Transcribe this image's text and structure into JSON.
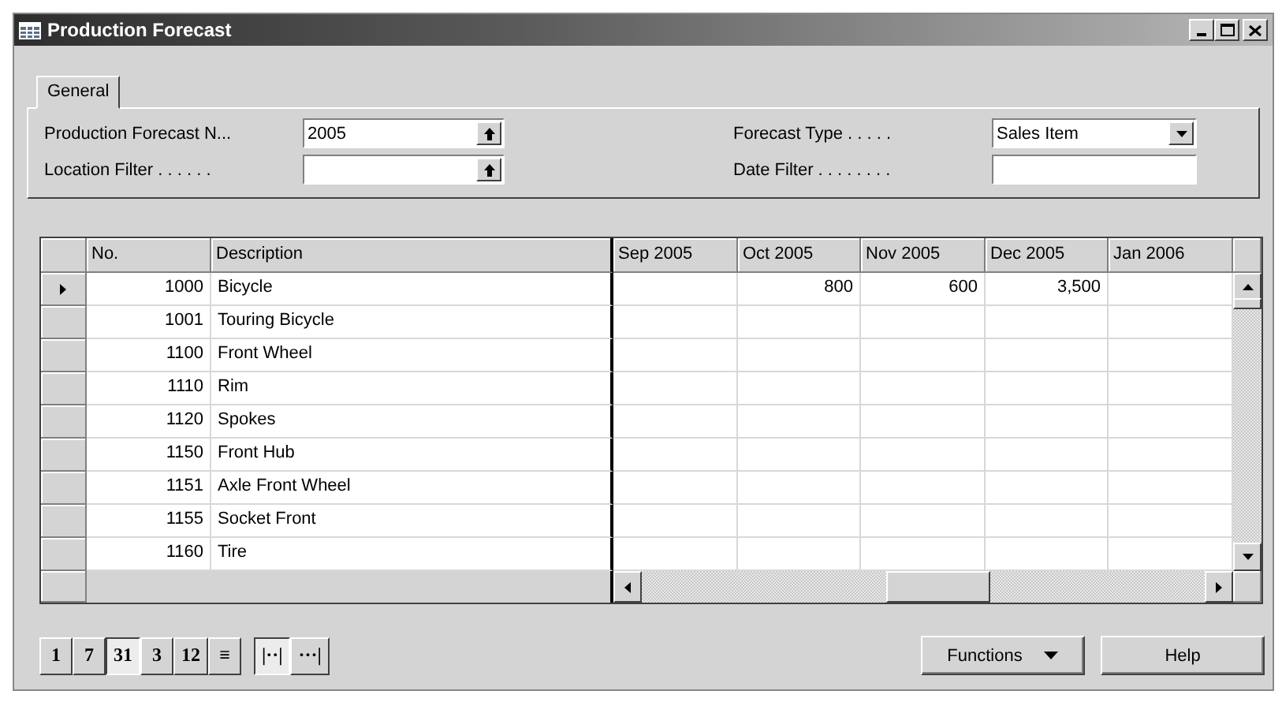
{
  "window": {
    "title": "Production Forecast"
  },
  "tabs": [
    {
      "label": "General",
      "selected": true
    }
  ],
  "left_fields": [
    {
      "label": "Production Forecast N...",
      "value": "2005",
      "kind": "lookup"
    },
    {
      "label": "Location Filter . . . . . .",
      "kind": "lookup"
    }
  ],
  "right_fields": [
    {
      "label": "Forecast Type . . . . .",
      "value": "Sales Item",
      "kind": "dropdown"
    },
    {
      "label": "Date Filter . . . . . . . .",
      "kind": "text"
    }
  ],
  "table": {
    "columns": [
      "No.",
      "Description",
      "Sep 2005",
      "Oct 2005",
      "Nov 2005",
      "Dec 2005",
      "Jan 2006"
    ],
    "rows": [
      {
        "no": "1000",
        "description": "Bicycle",
        "selected": true,
        "values": {
          "1": "800",
          "2": "600",
          "3": "3,500"
        }
      },
      {
        "no": "1001",
        "description": "Touring Bicycle",
        "selected": false
      },
      {
        "no": "1100",
        "description": "Front Wheel",
        "selected": false
      },
      {
        "no": "1110",
        "description": "Rim",
        "selected": false
      },
      {
        "no": "1120",
        "description": "Spokes",
        "selected": false
      },
      {
        "no": "1150",
        "description": "Front Hub",
        "selected": false
      },
      {
        "no": "1151",
        "description": "Axle Front Wheel",
        "selected": false
      },
      {
        "no": "1155",
        "description": "Socket Front",
        "selected": false
      },
      {
        "no": "1160",
        "description": "Tire",
        "selected": false
      }
    ]
  },
  "period_buttons": [
    {
      "label": "1",
      "selected": false
    },
    {
      "label": "7",
      "selected": false
    },
    {
      "label": "31",
      "selected": true
    },
    {
      "label": "3",
      "selected": false
    },
    {
      "label": "12",
      "selected": false
    },
    {
      "label": "≡",
      "selected": false
    }
  ],
  "amount_buttons": [
    {
      "label": "|··|",
      "selected": true
    },
    {
      "label": "···|",
      "selected": false
    }
  ],
  "buttons": [
    {
      "label": "Functions",
      "kind": "menu"
    },
    {
      "label": "Help",
      "kind": "plain"
    }
  ]
}
